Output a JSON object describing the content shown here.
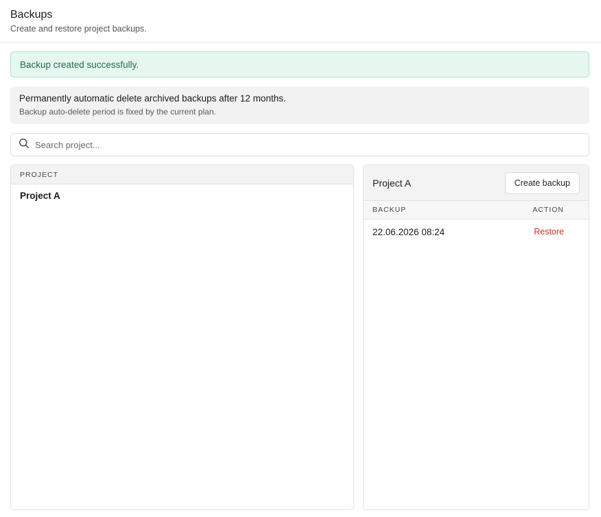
{
  "header": {
    "title": "Backups",
    "subtitle": "Create and restore project backups."
  },
  "alert": {
    "message": "Backup created successfully.",
    "color": "#1f6b4e"
  },
  "info": {
    "title": "Permanently automatic delete archived backups after 12 months.",
    "subtitle": "Backup auto-delete period is fixed by the current plan."
  },
  "search": {
    "placeholder": "Search project...",
    "value": "",
    "icon": "search-icon"
  },
  "projects": {
    "column_header": "PROJECT",
    "items": [
      "Project A"
    ]
  },
  "detail": {
    "project_name": "Project A",
    "create_button_label": "Create backup",
    "columns": {
      "backup": "BACKUP",
      "action": "ACTION"
    },
    "rows": [
      {
        "date": "22.06.2026 08:24",
        "action_label": "Restore"
      }
    ],
    "action_color": "#d42b2b"
  }
}
